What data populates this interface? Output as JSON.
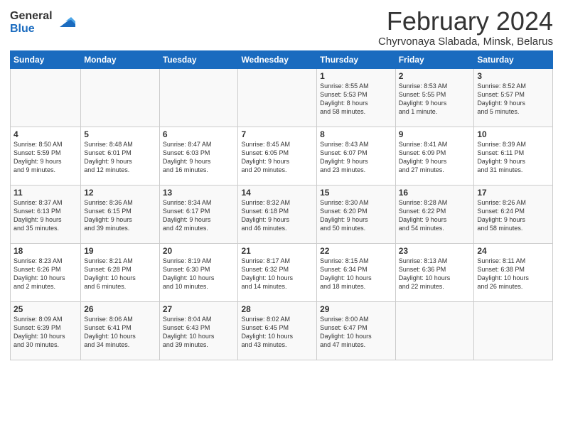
{
  "logo": {
    "general": "General",
    "blue": "Blue"
  },
  "title": "February 2024",
  "subtitle": "Chyrvonaya Slabada, Minsk, Belarus",
  "headers": [
    "Sunday",
    "Monday",
    "Tuesday",
    "Wednesday",
    "Thursday",
    "Friday",
    "Saturday"
  ],
  "weeks": [
    [
      {
        "num": "",
        "info": ""
      },
      {
        "num": "",
        "info": ""
      },
      {
        "num": "",
        "info": ""
      },
      {
        "num": "",
        "info": ""
      },
      {
        "num": "1",
        "info": "Sunrise: 8:55 AM\nSunset: 5:53 PM\nDaylight: 8 hours\nand 58 minutes."
      },
      {
        "num": "2",
        "info": "Sunrise: 8:53 AM\nSunset: 5:55 PM\nDaylight: 9 hours\nand 1 minute."
      },
      {
        "num": "3",
        "info": "Sunrise: 8:52 AM\nSunset: 5:57 PM\nDaylight: 9 hours\nand 5 minutes."
      }
    ],
    [
      {
        "num": "4",
        "info": "Sunrise: 8:50 AM\nSunset: 5:59 PM\nDaylight: 9 hours\nand 9 minutes."
      },
      {
        "num": "5",
        "info": "Sunrise: 8:48 AM\nSunset: 6:01 PM\nDaylight: 9 hours\nand 12 minutes."
      },
      {
        "num": "6",
        "info": "Sunrise: 8:47 AM\nSunset: 6:03 PM\nDaylight: 9 hours\nand 16 minutes."
      },
      {
        "num": "7",
        "info": "Sunrise: 8:45 AM\nSunset: 6:05 PM\nDaylight: 9 hours\nand 20 minutes."
      },
      {
        "num": "8",
        "info": "Sunrise: 8:43 AM\nSunset: 6:07 PM\nDaylight: 9 hours\nand 23 minutes."
      },
      {
        "num": "9",
        "info": "Sunrise: 8:41 AM\nSunset: 6:09 PM\nDaylight: 9 hours\nand 27 minutes."
      },
      {
        "num": "10",
        "info": "Sunrise: 8:39 AM\nSunset: 6:11 PM\nDaylight: 9 hours\nand 31 minutes."
      }
    ],
    [
      {
        "num": "11",
        "info": "Sunrise: 8:37 AM\nSunset: 6:13 PM\nDaylight: 9 hours\nand 35 minutes."
      },
      {
        "num": "12",
        "info": "Sunrise: 8:36 AM\nSunset: 6:15 PM\nDaylight: 9 hours\nand 39 minutes."
      },
      {
        "num": "13",
        "info": "Sunrise: 8:34 AM\nSunset: 6:17 PM\nDaylight: 9 hours\nand 42 minutes."
      },
      {
        "num": "14",
        "info": "Sunrise: 8:32 AM\nSunset: 6:18 PM\nDaylight: 9 hours\nand 46 minutes."
      },
      {
        "num": "15",
        "info": "Sunrise: 8:30 AM\nSunset: 6:20 PM\nDaylight: 9 hours\nand 50 minutes."
      },
      {
        "num": "16",
        "info": "Sunrise: 8:28 AM\nSunset: 6:22 PM\nDaylight: 9 hours\nand 54 minutes."
      },
      {
        "num": "17",
        "info": "Sunrise: 8:26 AM\nSunset: 6:24 PM\nDaylight: 9 hours\nand 58 minutes."
      }
    ],
    [
      {
        "num": "18",
        "info": "Sunrise: 8:23 AM\nSunset: 6:26 PM\nDaylight: 10 hours\nand 2 minutes."
      },
      {
        "num": "19",
        "info": "Sunrise: 8:21 AM\nSunset: 6:28 PM\nDaylight: 10 hours\nand 6 minutes."
      },
      {
        "num": "20",
        "info": "Sunrise: 8:19 AM\nSunset: 6:30 PM\nDaylight: 10 hours\nand 10 minutes."
      },
      {
        "num": "21",
        "info": "Sunrise: 8:17 AM\nSunset: 6:32 PM\nDaylight: 10 hours\nand 14 minutes."
      },
      {
        "num": "22",
        "info": "Sunrise: 8:15 AM\nSunset: 6:34 PM\nDaylight: 10 hours\nand 18 minutes."
      },
      {
        "num": "23",
        "info": "Sunrise: 8:13 AM\nSunset: 6:36 PM\nDaylight: 10 hours\nand 22 minutes."
      },
      {
        "num": "24",
        "info": "Sunrise: 8:11 AM\nSunset: 6:38 PM\nDaylight: 10 hours\nand 26 minutes."
      }
    ],
    [
      {
        "num": "25",
        "info": "Sunrise: 8:09 AM\nSunset: 6:39 PM\nDaylight: 10 hours\nand 30 minutes."
      },
      {
        "num": "26",
        "info": "Sunrise: 8:06 AM\nSunset: 6:41 PM\nDaylight: 10 hours\nand 34 minutes."
      },
      {
        "num": "27",
        "info": "Sunrise: 8:04 AM\nSunset: 6:43 PM\nDaylight: 10 hours\nand 39 minutes."
      },
      {
        "num": "28",
        "info": "Sunrise: 8:02 AM\nSunset: 6:45 PM\nDaylight: 10 hours\nand 43 minutes."
      },
      {
        "num": "29",
        "info": "Sunrise: 8:00 AM\nSunset: 6:47 PM\nDaylight: 10 hours\nand 47 minutes."
      },
      {
        "num": "",
        "info": ""
      },
      {
        "num": "",
        "info": ""
      }
    ]
  ]
}
